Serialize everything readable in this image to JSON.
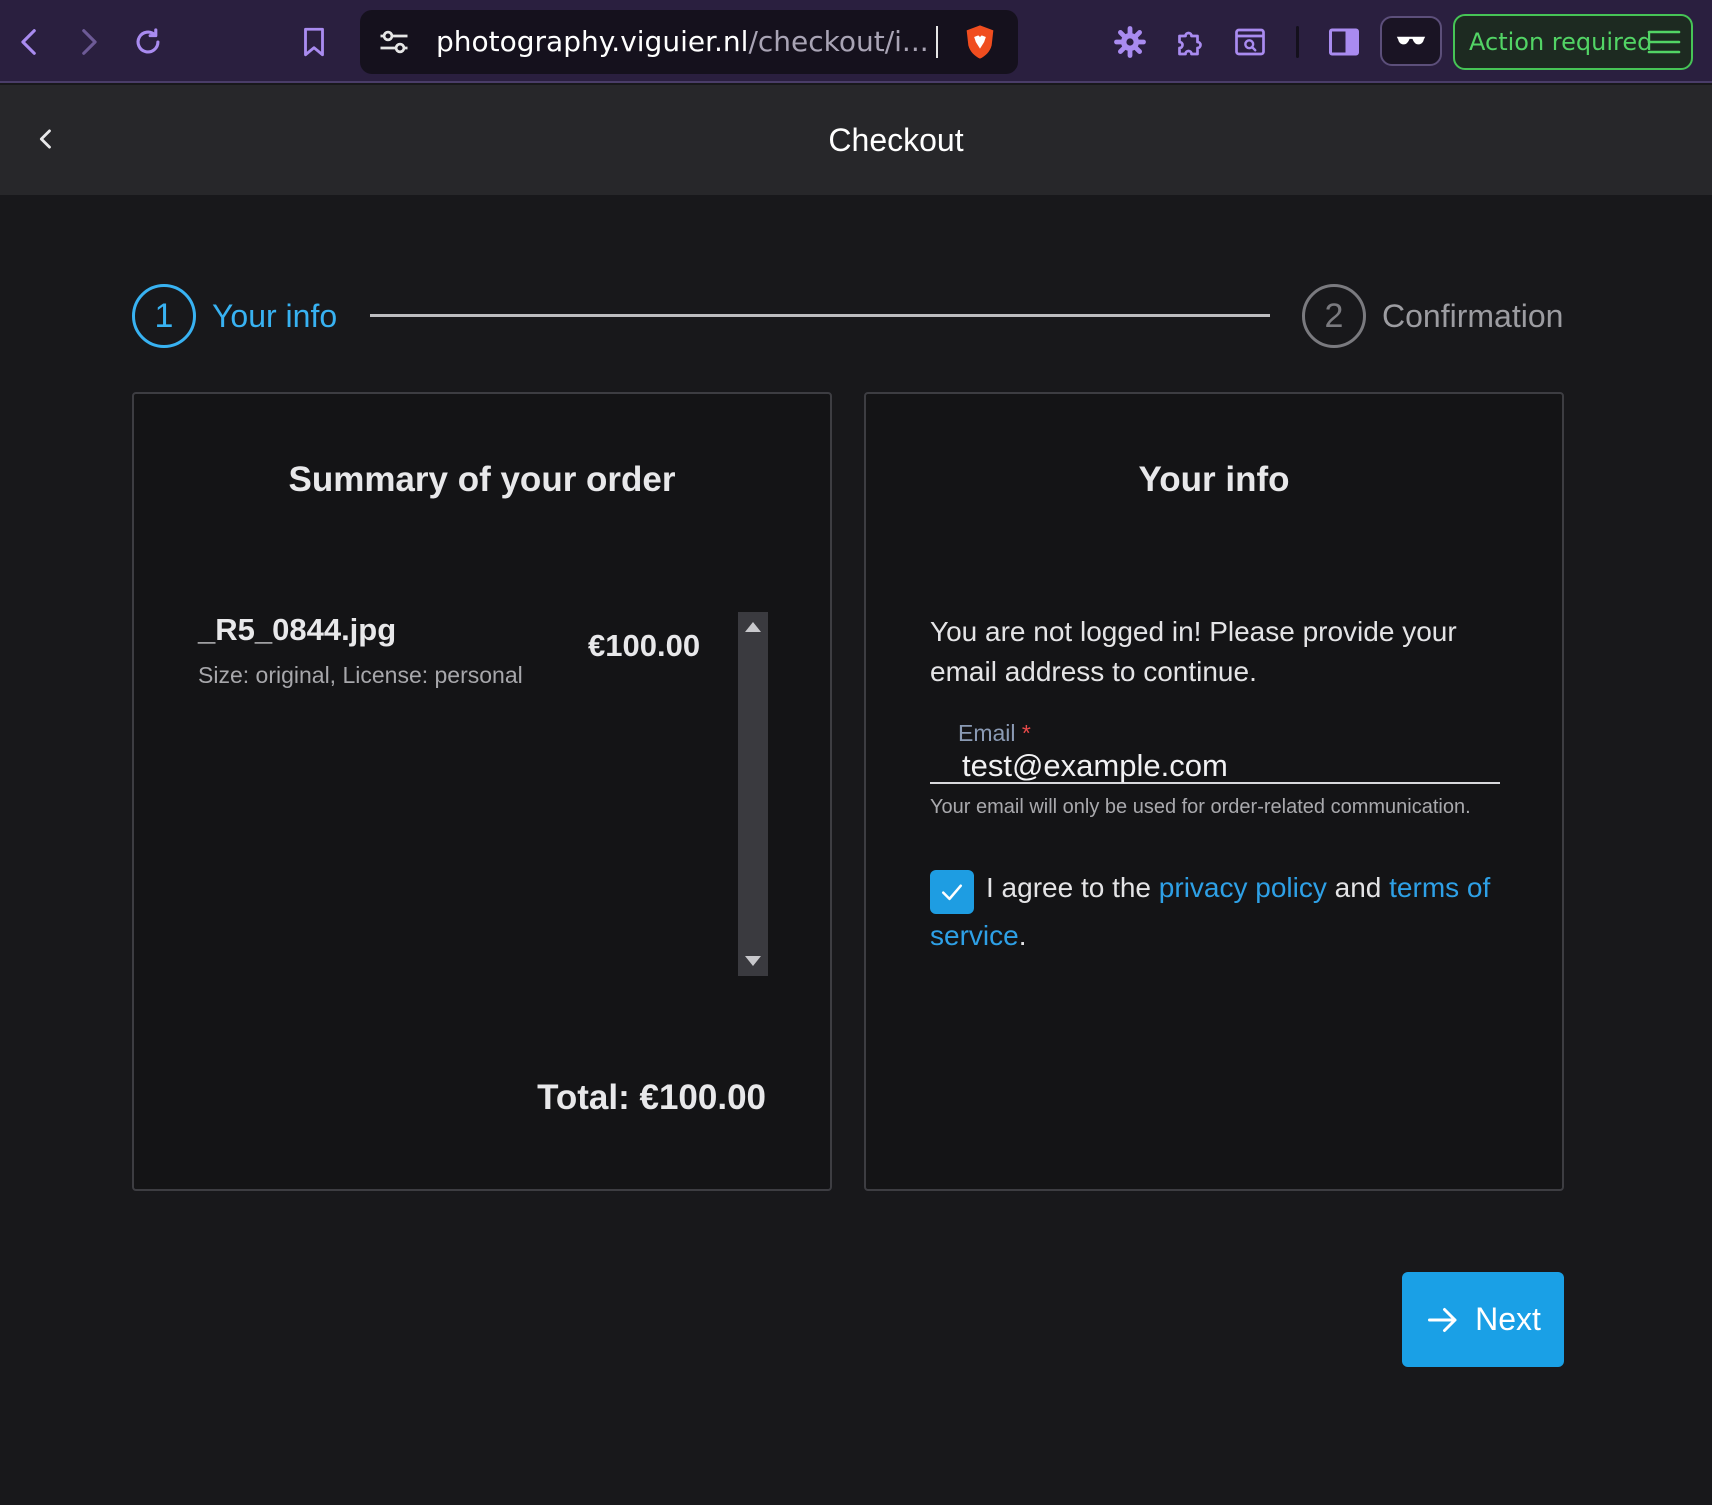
{
  "browser": {
    "url_host": "photography.viguier.nl",
    "url_path": "/checkout/i...",
    "action_label": "Action required",
    "icons": [
      "back-icon",
      "forward-icon",
      "reload-icon",
      "bookmark-icon",
      "site-settings-icon",
      "brave-shield-icon",
      "settings-icon",
      "extensions-icon",
      "screenshot-search-icon",
      "sidebar-icon",
      "reader-mode-icon",
      "menu-icon"
    ],
    "colors": {
      "chrome_bg": "#2a1f3f",
      "action_green": "#52d465"
    }
  },
  "header": {
    "title": "Checkout"
  },
  "stepper": {
    "steps": [
      {
        "number": "1",
        "label": "Your info",
        "active": true
      },
      {
        "number": "2",
        "label": "Confirmation",
        "active": false
      }
    ],
    "active_color": "#38b2f2"
  },
  "order": {
    "title": "Summary of your order",
    "items": [
      {
        "name": "_R5_0844.jpg",
        "meta": "Size: original, License: personal",
        "price": "€100.00"
      }
    ],
    "total": "Total: €100.00"
  },
  "info": {
    "title": "Your info",
    "message": "You are not logged in! Please provide your email address to continue.",
    "email_label": "Email",
    "email_required": "*",
    "email_value": "test@example.com",
    "email_hint": "Your email will only be used for order-related communication.",
    "agree_checked": true,
    "agree_prefix": "I agree to the",
    "privacy_link": "privacy policy",
    "agree_and": "and",
    "terms_link": "terms of service",
    "agree_suffix": "."
  },
  "actions": {
    "next_label": "Next",
    "accent": "#1aa0e6"
  }
}
